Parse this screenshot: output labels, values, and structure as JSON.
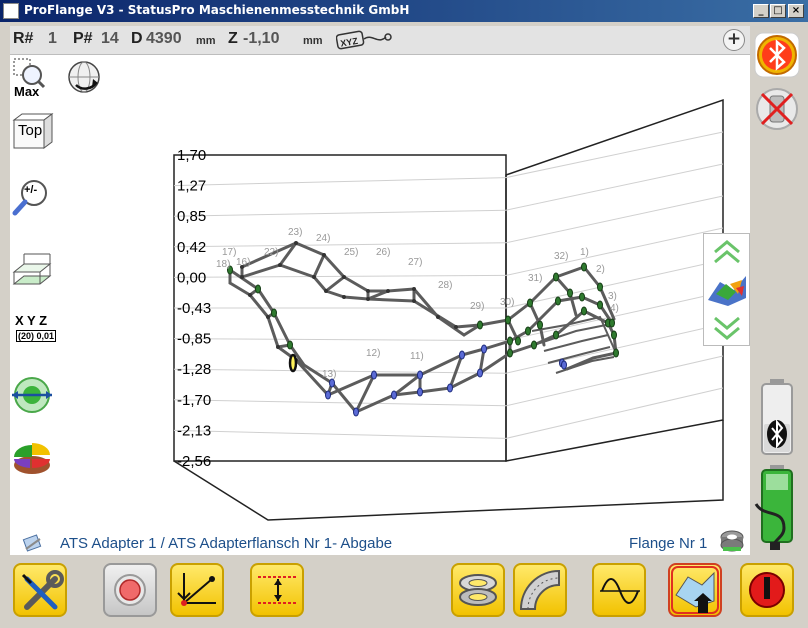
{
  "window": {
    "title": "ProFlange V3 - StatusPro Maschienenmesstechnik GmbH",
    "buttons": {
      "minimize": "_",
      "maximize": "□",
      "close": "×"
    }
  },
  "status": {
    "r_label": "R#",
    "r_value": "1",
    "p_label": "P#",
    "p_value": "14",
    "d_label": "D",
    "d_value": "4390",
    "d_unit": "mm",
    "z_label": "Z",
    "z_value": "-1,10",
    "z_unit": "mm",
    "xyz_badge_text": "XYZ",
    "add_label": "+"
  },
  "left_tools": {
    "max_label": "Max",
    "top_label": "Top",
    "zoom_label": "+/-",
    "xyz_label": "X Y Z",
    "xyz_sub": "(20) 0,01"
  },
  "chart_data": {
    "type": "scatter",
    "ylabels": [
      "1,70",
      "1,27",
      "0,85",
      "0,42",
      "0,00",
      "-0,43",
      "-0,85",
      "-1,28",
      "-1,70",
      "-2,13",
      "-2,56"
    ],
    "ylim": [
      -2.56,
      1.7
    ],
    "point_labels": [
      "1)",
      "2)",
      "3)",
      "4)",
      "11)",
      "12)",
      "13)",
      "16)",
      "17)",
      "18)",
      "22)",
      "23)",
      "24)",
      "25)",
      "26)",
      "27)",
      "28)",
      "29)",
      "30)",
      "31)",
      "32)"
    ]
  },
  "footer": {
    "path": "ATS Adapter 1 / ATS Adapterflansch Nr 1- Abgabe",
    "flange": "Flange Nr 1"
  },
  "right_tools": {
    "bluetooth": "bluetooth-icon",
    "laser": "laser-off-icon",
    "battery_bt": "battery-bluetooth-icon",
    "battery_power": "battery-power-icon"
  },
  "colors": {
    "accent": "#f2c200",
    "link": "#1d4f8a",
    "green_point": "#2f7a2f",
    "blue_point": "#5b6bd6"
  }
}
